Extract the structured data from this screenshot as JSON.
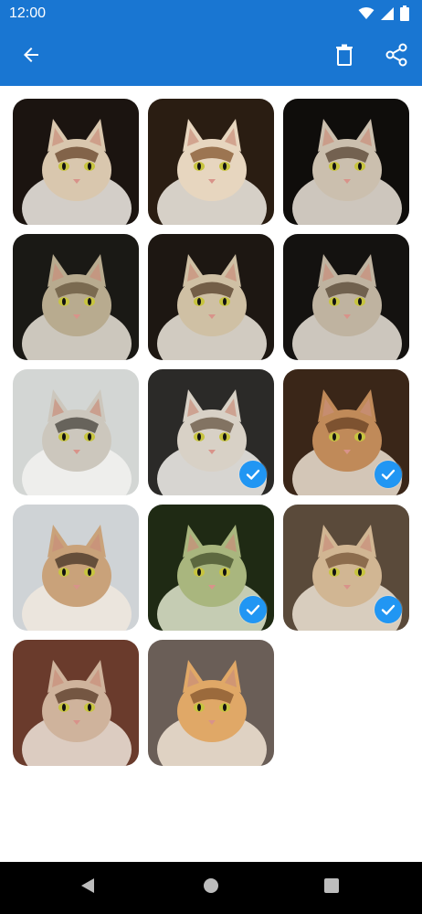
{
  "status_bar": {
    "time": "12:00",
    "icons": [
      "wifi-icon",
      "signal-icon",
      "battery-icon"
    ]
  },
  "app_bar": {
    "background": "#1976d2",
    "actions": [
      "back-arrow-icon",
      "delete-icon",
      "share-icon"
    ]
  },
  "gallery": {
    "selected_color": "#2196f3",
    "photos": [
      {
        "subject": "cat",
        "selected": false
      },
      {
        "subject": "cat",
        "selected": false
      },
      {
        "subject": "cat",
        "selected": false
      },
      {
        "subject": "cat",
        "selected": false
      },
      {
        "subject": "cat",
        "selected": false
      },
      {
        "subject": "cat",
        "selected": false
      },
      {
        "subject": "cat",
        "selected": false
      },
      {
        "subject": "cat",
        "selected": true
      },
      {
        "subject": "cat",
        "selected": true
      },
      {
        "subject": "cat",
        "selected": false
      },
      {
        "subject": "cat",
        "selected": true
      },
      {
        "subject": "cat",
        "selected": true
      },
      {
        "subject": "cat",
        "selected": false
      },
      {
        "subject": "cat",
        "selected": false
      }
    ]
  },
  "nav_bar": {
    "buttons": [
      "nav-back-icon",
      "nav-home-icon",
      "nav-recents-icon"
    ]
  }
}
